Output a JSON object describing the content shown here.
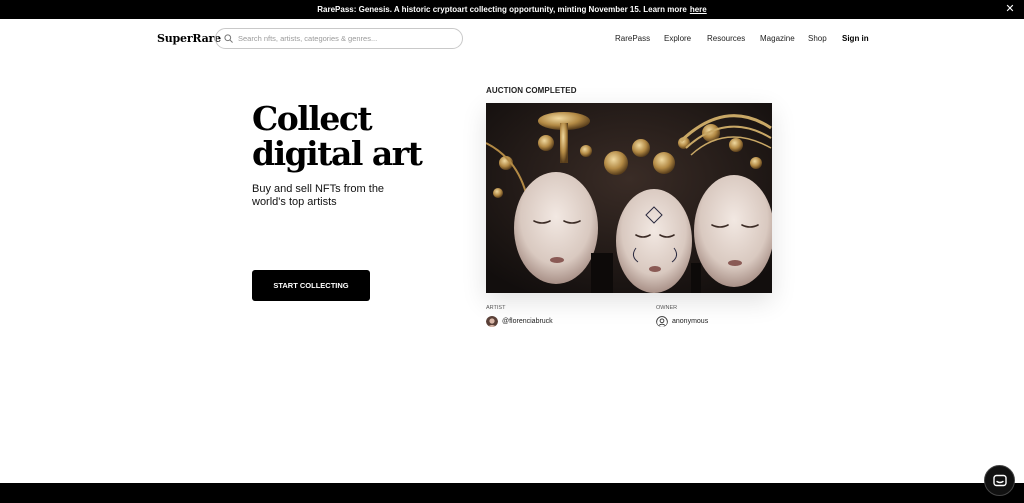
{
  "announcement": {
    "text": "RarePass: Genesis. A historic cryptoart collecting opportunity, minting November 15. Learn more",
    "link_label": "here",
    "close_symbol": "✕"
  },
  "header": {
    "logo": "SuperRare",
    "search_placeholder": "Search nfts, artists, categories & genres...",
    "nav": {
      "rarepass": "RarePass",
      "explore": "Explore",
      "resources": "Resources",
      "magazine": "Magazine",
      "shop": "Shop",
      "signin": "Sign in"
    }
  },
  "hero": {
    "title": "Collect digital art",
    "subtitle": "Buy and sell NFTs from the world's top artists",
    "cta": "START COLLECTING"
  },
  "feature": {
    "status": "AUCTION COMPLETED",
    "artist_label": "ARTIST",
    "artist": "@florenciabruck",
    "owner_label": "OWNER",
    "owner": "anonymous"
  },
  "colors": {
    "announcement_bg": "#000000",
    "cta_bg": "#000000",
    "artwork_bg": "#1a1514"
  },
  "icons": {
    "search": "search-icon",
    "close": "close-icon",
    "owner_avatar": "user-icon",
    "chat": "chat-icon"
  }
}
